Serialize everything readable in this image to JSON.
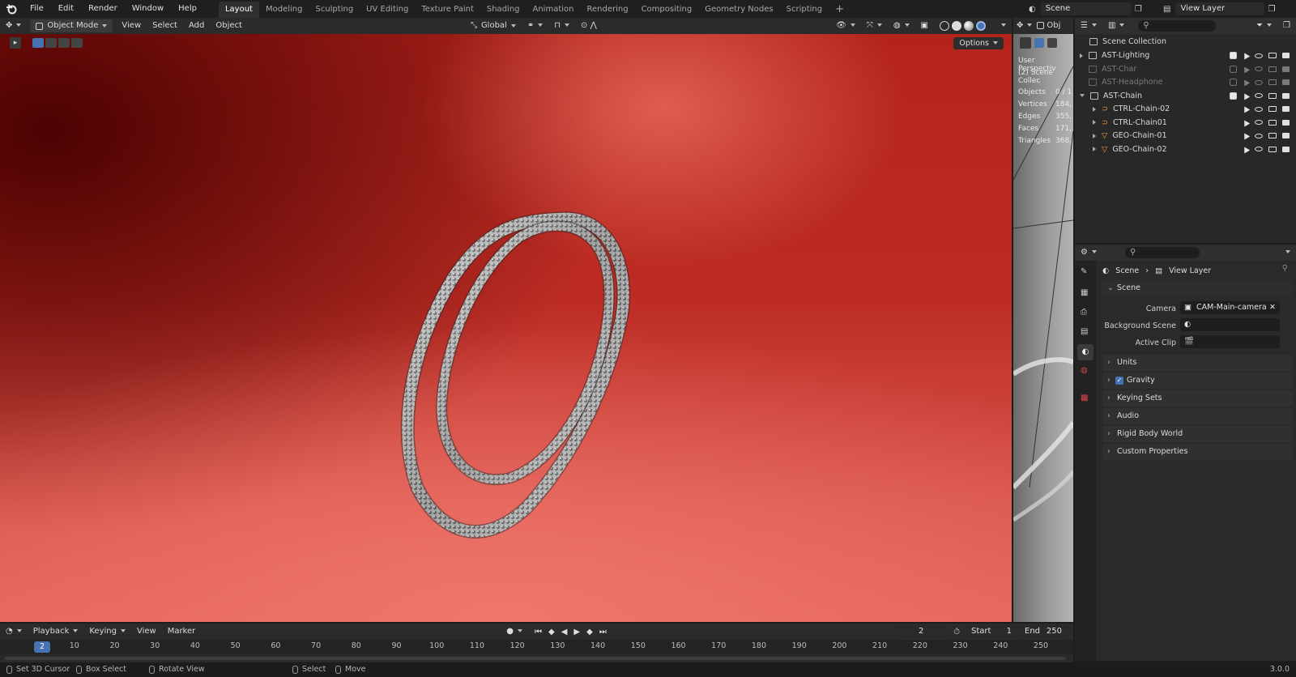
{
  "menu": {
    "items": [
      "File",
      "Edit",
      "Render",
      "Window",
      "Help"
    ]
  },
  "workspaces": {
    "tabs": [
      "Layout",
      "Modeling",
      "Sculpting",
      "UV Editing",
      "Texture Paint",
      "Shading",
      "Animation",
      "Rendering",
      "Compositing",
      "Geometry Nodes",
      "Scripting"
    ],
    "active": "Layout",
    "add": "+"
  },
  "topright": {
    "scene_value": "Scene",
    "view_layer_value": "View Layer"
  },
  "viewport_header": {
    "mode": "Object Mode",
    "menus": [
      "View",
      "Select",
      "Add",
      "Object"
    ],
    "orientation": "Global",
    "options": "Options"
  },
  "mini_viewport": {
    "header_label": "Obj",
    "overlay_line1": "User Perspectiv",
    "overlay_line2": "(2) Scene Collec",
    "stats": [
      {
        "label": "Objects",
        "value": "0 / 1"
      },
      {
        "label": "Vertices",
        "value": "184,"
      },
      {
        "label": "Edges",
        "value": "355,"
      },
      {
        "label": "Faces",
        "value": "171,"
      },
      {
        "label": "Triangles",
        "value": "368,"
      }
    ]
  },
  "outliner": {
    "root": "Scene Collection",
    "rows": [
      {
        "label": "AST-Lighting",
        "indent": 1,
        "open": false,
        "dim": false,
        "checked": true,
        "type": "collection"
      },
      {
        "label": "AST-Char",
        "indent": 1,
        "open": null,
        "dim": true,
        "checked": false,
        "type": "collection"
      },
      {
        "label": "AST-Headphone",
        "indent": 1,
        "open": null,
        "dim": true,
        "checked": false,
        "type": "collection"
      },
      {
        "label": "AST-Chain",
        "indent": 1,
        "open": true,
        "dim": false,
        "checked": true,
        "type": "collection"
      },
      {
        "label": "CTRL-Chain-02",
        "indent": 2,
        "open": false,
        "dim": false,
        "checked": null,
        "type": "curve"
      },
      {
        "label": "CTRL-Chain01",
        "indent": 2,
        "open": false,
        "dim": false,
        "checked": null,
        "type": "curve"
      },
      {
        "label": "GEO-Chain-01",
        "indent": 2,
        "open": false,
        "dim": false,
        "checked": null,
        "type": "mesh"
      },
      {
        "label": "GEO-Chain-02",
        "indent": 2,
        "open": false,
        "dim": false,
        "checked": null,
        "type": "mesh"
      }
    ]
  },
  "properties": {
    "breadcrumb_scene": "Scene",
    "breadcrumb_sep": "›",
    "breadcrumb_viewlayer": "View Layer",
    "scene_panel": "Scene",
    "camera_label": "Camera",
    "camera_value": "CAM-Main-camera",
    "bg_scene_label": "Background Scene",
    "active_clip_label": "Active Clip",
    "panels": [
      "Units",
      "Gravity",
      "Keying Sets",
      "Audio",
      "Rigid Body World",
      "Custom Properties"
    ],
    "gravity_checked": true
  },
  "timeline": {
    "menus": [
      "Playback",
      "Keying",
      "View",
      "Marker"
    ],
    "current_frame": "2",
    "start_label": "Start",
    "start_value": "1",
    "end_label": "End",
    "end_value": "250",
    "ticks": [
      "10",
      "20",
      "30",
      "40",
      "50",
      "60",
      "70",
      "80",
      "90",
      "100",
      "110",
      "120",
      "130",
      "140",
      "150",
      "160",
      "170",
      "180",
      "190",
      "200",
      "210",
      "220",
      "230",
      "240",
      "250"
    ]
  },
  "statusbar": {
    "items": [
      "Set 3D Cursor",
      "Box Select",
      "Rotate View",
      "Select",
      "Move"
    ],
    "version": "3.0.0"
  },
  "colors": {
    "accent_blue": "#4772b3",
    "viewport_red": "#c0302a",
    "mesh_orange": "#e89a3c"
  }
}
